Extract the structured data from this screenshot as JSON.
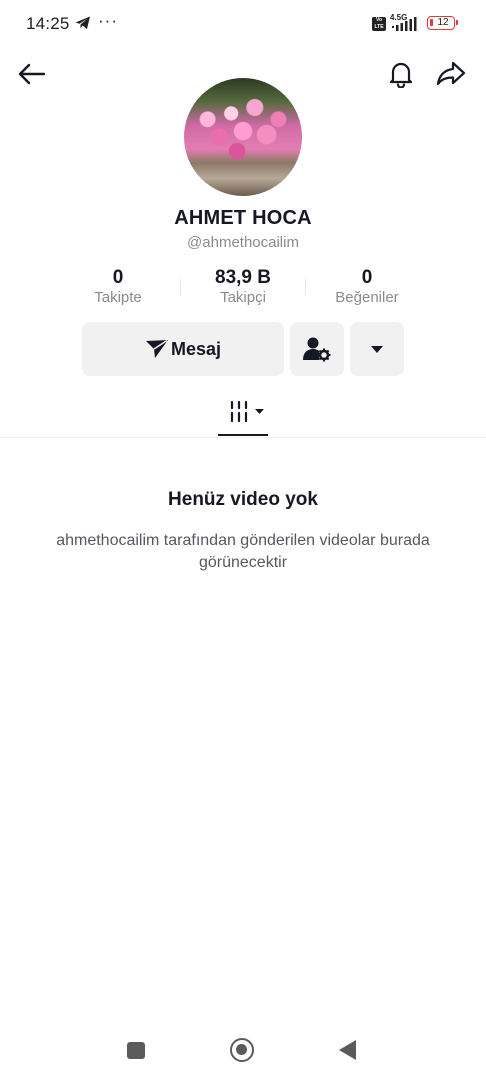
{
  "status_bar": {
    "time": "14:25",
    "more": "···",
    "volte": "Vo LTE",
    "network": "4.5G",
    "battery": "12",
    "icons": [
      "telegram-icon",
      "signal-icon",
      "battery-icon"
    ]
  },
  "header": {
    "icons": [
      "back-arrow-icon",
      "bell-icon",
      "share-icon"
    ]
  },
  "profile": {
    "name": "AHMET HOCA",
    "handle": "@ahmethocailim"
  },
  "stats": [
    {
      "value": "0",
      "label": "Takipte"
    },
    {
      "value": "83,9 B",
      "label": "Takipçi"
    },
    {
      "value": "0",
      "label": "Beğeniler"
    }
  ],
  "actions": {
    "message_label": "Mesaj",
    "icons": [
      "send-icon",
      "user-settings-icon",
      "caret-down-icon"
    ]
  },
  "tabs": {
    "icons": [
      "videos-grid-icon",
      "tab-caret-icon"
    ]
  },
  "empty_state": {
    "title": "Henüz video yok",
    "description": "ahmethocailim tarafından gönderilen videolar burada görünecektir"
  },
  "nav_bar": {
    "icons": [
      "recents-icon",
      "home-icon",
      "back-icon"
    ]
  },
  "colors": {
    "text_primary": "#161823",
    "text_secondary": "#8a8b91",
    "button_bg": "#f1f1f2",
    "battery_low": "#e03a3a"
  }
}
